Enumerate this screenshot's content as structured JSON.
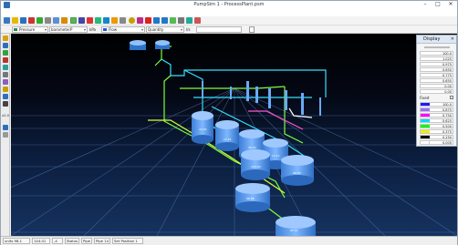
{
  "window": {
    "title": "PumpSim 1 - ProcessPlant.psm",
    "controls": [
      "–",
      "□",
      "✕"
    ]
  },
  "menu": [
    "File",
    "Edit",
    "View",
    "Saved views",
    "Run",
    "Tools",
    "Settings",
    "Window",
    "Help"
  ],
  "toolbar2": {
    "dropdown1": {
      "value": "Pressure",
      "swatch": "#2e8b57"
    },
    "dropdown2": {
      "value": "barometerP"
    },
    "unit": "kPa",
    "dropdown3": {
      "value": "Flow",
      "swatch": "#1e5ad8"
    },
    "dropdown4": {
      "value": "Quantity"
    },
    "unit2": "l/s",
    "search_placeholder": ""
  },
  "left_toolbar": {
    "zoom": "x2.0"
  },
  "display_panel": {
    "title": "Display",
    "close": "✕",
    "values": [
      "100.0",
      "1.025",
      "0.975",
      "0.650",
      "0.775",
      "0.650",
      "0.00",
      "0.00"
    ],
    "mode": "Fixed",
    "colors": [
      {
        "value": "100.0",
        "color": "#1a1aff"
      },
      {
        "value": "0.875",
        "color": "#9a6cff"
      },
      {
        "value": "0.750",
        "color": "#ff00ff"
      },
      {
        "value": "0.625",
        "color": "#00d8ff"
      },
      {
        "value": "0.500",
        "color": "#00ff00"
      },
      {
        "value": "0.375",
        "color": "#f0f000"
      },
      {
        "value": "0.250",
        "color": "#000000"
      },
      {
        "value": "0.000",
        "color": "#ffffff"
      }
    ]
  },
  "scene": {
    "labels": [
      "44.50",
      "17.21",
      "46.50",
      "17.11",
      "100.00",
      "98.55",
      "98.86",
      "66.91"
    ]
  },
  "status": {
    "coord": "units 98.1",
    "ticks": "144.01",
    "t": "-4",
    "status_label": "Status",
    "pipe": "Pipe",
    "pipe_id": "Pipe 14",
    "set_pos": "Set Position 1"
  },
  "colors": {
    "accent": "#2d6db5",
    "pipe_green": "#7dff3c",
    "pipe_cyan": "#30e6ff"
  }
}
